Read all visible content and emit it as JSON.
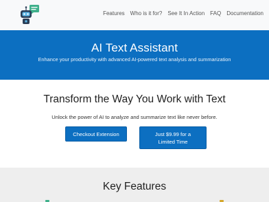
{
  "nav": {
    "logo_icon": "robot-chat-icon",
    "links": [
      "Features",
      "Who is it for?",
      "See It In Action",
      "FAQ",
      "Documentation"
    ]
  },
  "hero": {
    "title": "AI Text Assistant",
    "subtitle": "Enhance your productivity with advanced AI-powered text analysis and summarization"
  },
  "cta": {
    "title": "Transform the Way You Work with Text",
    "text": "Unlock the power of AI to analyze and summarize text like never before.",
    "checkout_label": "Checkout Extension",
    "price_label": "Just $9.99 for a Limited Time"
  },
  "features": {
    "title": "Key Features"
  },
  "colors": {
    "primary": "#0c6fc1",
    "nav_bg": "#f8f9fa",
    "section_bg": "#eeeeee",
    "chat_bubble": "#3fb08b"
  }
}
